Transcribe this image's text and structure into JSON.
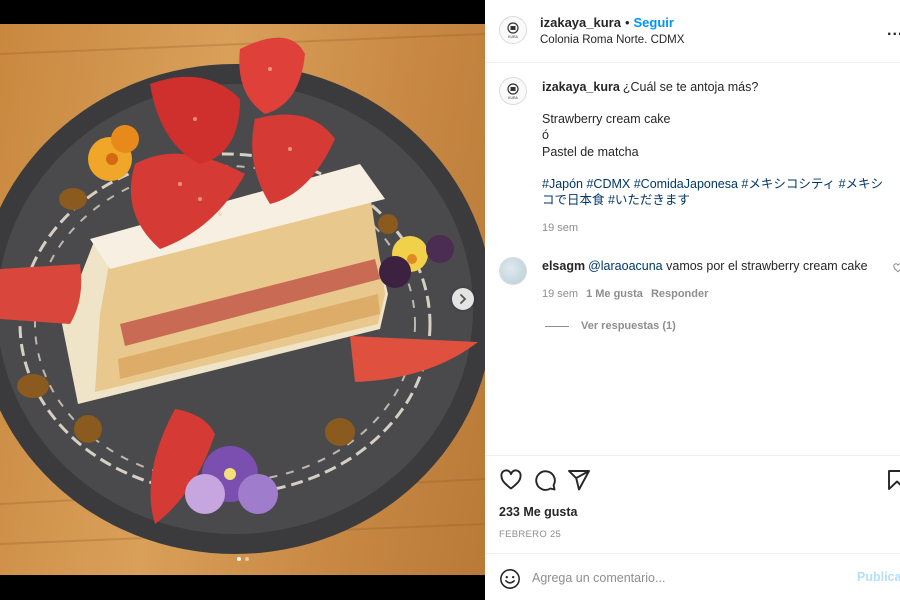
{
  "post": {
    "username": "izakaya_kura",
    "follow_label": "Seguir",
    "location": "Colonia Roma Norte. CDMX",
    "more_label": "...",
    "avatar_text": "KURA"
  },
  "caption": {
    "username": "izakaya_kura",
    "question": "¿Cuál se te antoja más?",
    "option1": "Strawberry cream cake",
    "option_sep": "ó",
    "option2": "Pastel de matcha",
    "hashtags_line1": "#Japón #CDMX #ComidaJaponesa #メキシコシティ #メキシ",
    "hashtags_line2": "コで日本食 #いただきます",
    "time": "19 sem"
  },
  "comment": {
    "username": "elsagm",
    "mention": "@laraoacuna",
    "text": " vamos por el strawberry cream cake",
    "time": "19 sem",
    "likes": "1 Me gusta",
    "reply_label": "Responder",
    "view_replies": "Ver respuestas (1)"
  },
  "actions": {
    "likes": "233 Me gusta",
    "date": "FEBRERO 25"
  },
  "compose": {
    "placeholder": "Agrega un comentario...",
    "publish_label": "Publicar"
  },
  "carousel": {
    "current": 1,
    "total": 2
  },
  "colors": {
    "link": "#0095f6",
    "hashtag": "#00376b",
    "publish_disabled": "#b2dffc",
    "meta_gray": "#8e8e8e"
  },
  "icons": [
    "heart-icon",
    "comment-icon",
    "share-icon",
    "bookmark-icon",
    "emoji-icon",
    "chevron-right-icon"
  ]
}
